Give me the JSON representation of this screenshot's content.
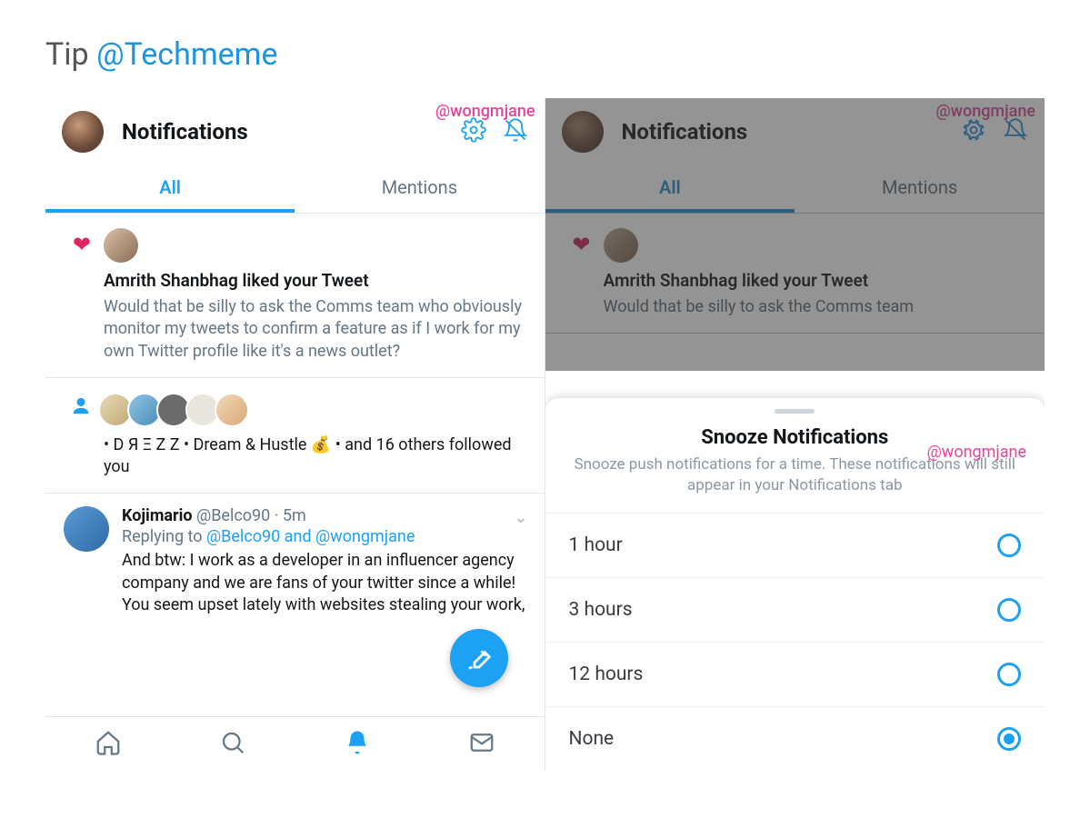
{
  "tip": {
    "prefix": "Tip ",
    "handle": "@Techmeme"
  },
  "watermark": "@wongmjane",
  "header": {
    "title": "Notifications"
  },
  "tabs": {
    "all": "All",
    "mentions": "Mentions"
  },
  "like_notif": {
    "title": "Amrith Shanbhag liked your Tweet",
    "body": "Would that be silly to ask the Comms team who obviously monitor my tweets to confirm a feature as if I work for my own Twitter profile like it's a news outlet?"
  },
  "follow_notif": {
    "line": "• D Я Ξ Z Z • Dream & Hustle 💰 • and 16 others followed you"
  },
  "reply": {
    "name": "Kojimario",
    "meta": "@Belco90 · 5m",
    "replying_prefix": "Replying to ",
    "replying_links": "@Belco90 and @wongmjane",
    "body": "And btw: I work as a developer in an influencer agency company and we are fans of your twitter since a while! You seem upset lately with websites stealing your work,"
  },
  "right_like": {
    "title": "Amrith Shanbhag liked your Tweet",
    "body": "Would that be silly to ask the Comms team"
  },
  "sheet": {
    "title": "Snooze Notifications",
    "subtitle": "Snooze push notifications for a time. These notifications will still appear in your Notifications tab",
    "options": [
      "1 hour",
      "3 hours",
      "12 hours",
      "None"
    ],
    "selected": 3
  }
}
